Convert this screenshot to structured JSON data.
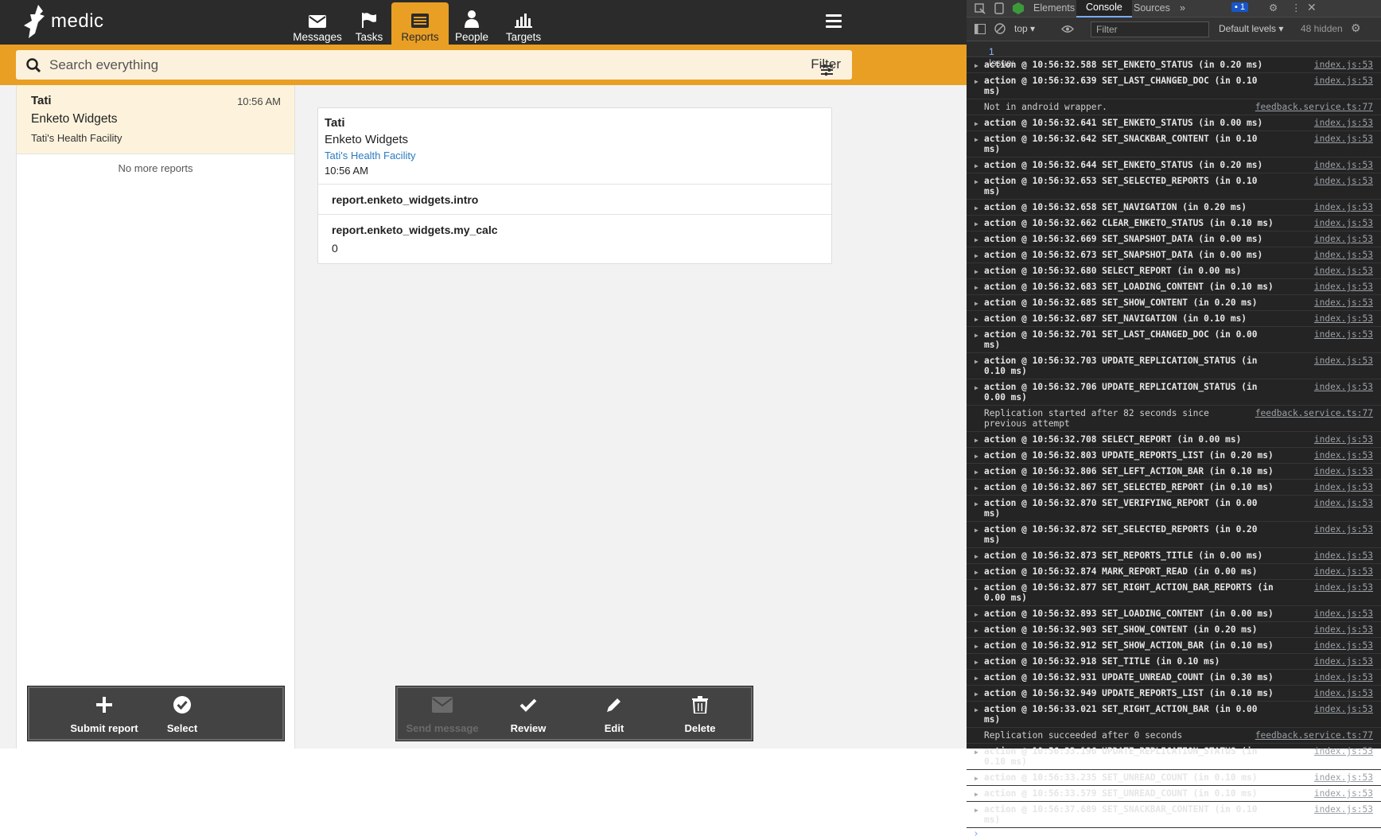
{
  "app": {
    "logo_text": "medic",
    "tabs": [
      {
        "label": "Messages",
        "icon": "envelope-icon",
        "active": false
      },
      {
        "label": "Tasks",
        "icon": "flag-icon",
        "active": false
      },
      {
        "label": "Reports",
        "icon": "list-icon",
        "active": true
      },
      {
        "label": "People",
        "icon": "person-icon",
        "active": false
      },
      {
        "label": "Targets",
        "icon": "bar-chart-icon",
        "active": false
      }
    ],
    "accent_color": "#e99f24",
    "search": {
      "placeholder": "Search everything",
      "value": ""
    },
    "filter_label": "Filter"
  },
  "report_list": {
    "items": [
      {
        "name": "Tati",
        "time": "10:56 AM",
        "form": "Enketo Widgets",
        "place": "Tati's Health Facility",
        "selected": true
      }
    ],
    "footer": "No more reports"
  },
  "report_detail": {
    "name": "Tati",
    "form": "Enketo Widgets",
    "place": "Tati's Health Facility",
    "time": "10:56 AM",
    "fields": [
      {
        "label": "report.enketo_widgets.intro",
        "value": ""
      },
      {
        "label": "report.enketo_widgets.my_calc",
        "value": "0"
      }
    ]
  },
  "left_actions": [
    {
      "label": "Submit report",
      "icon": "plus-icon",
      "enabled": true
    },
    {
      "label": "Select",
      "icon": "check-circle-icon",
      "enabled": true
    }
  ],
  "right_actions": [
    {
      "label": "Send message",
      "icon": "envelope-icon",
      "enabled": false
    },
    {
      "label": "Review",
      "icon": "check-icon",
      "enabled": true
    },
    {
      "label": "Edit",
      "icon": "pencil-icon",
      "enabled": true
    },
    {
      "label": "Delete",
      "icon": "trash-icon",
      "enabled": true
    }
  ],
  "devtools": {
    "tabs": [
      "Elements",
      "Console",
      "Sources"
    ],
    "active_tab": "Console",
    "issue_badge": "1",
    "context": "top",
    "filter_placeholder": "Filter",
    "levels": "Default levels",
    "hidden": "48 hidden",
    "issues_bar": "1 Issue:",
    "issues_count": "1",
    "logs": [
      {
        "msg": "action @ 10:56:32.588 SET_ENKETO_STATUS (in 0.20 ms)",
        "src": "index.js:53",
        "expandable": true
      },
      {
        "msg": "action @ 10:56:32.639 SET_LAST_CHANGED_DOC (in 0.10 ms)",
        "src": "index.js:53",
        "expandable": true
      },
      {
        "msg": "Not in android wrapper.",
        "src": "feedback.service.ts:77",
        "expandable": false
      },
      {
        "msg": "action @ 10:56:32.641 SET_ENKETO_STATUS (in 0.00 ms)",
        "src": "index.js:53",
        "expandable": true
      },
      {
        "msg": "action @ 10:56:32.642 SET_SNACKBAR_CONTENT (in 0.10 ms)",
        "src": "index.js:53",
        "expandable": true
      },
      {
        "msg": "action @ 10:56:32.644 SET_ENKETO_STATUS (in 0.20 ms)",
        "src": "index.js:53",
        "expandable": true
      },
      {
        "msg": "action @ 10:56:32.653 SET_SELECTED_REPORTS (in 0.10 ms)",
        "src": "index.js:53",
        "expandable": true
      },
      {
        "msg": "action @ 10:56:32.658 SET_NAVIGATION (in 0.20 ms)",
        "src": "index.js:53",
        "expandable": true
      },
      {
        "msg": "action @ 10:56:32.662 CLEAR_ENKETO_STATUS (in 0.10 ms)",
        "src": "index.js:53",
        "expandable": true
      },
      {
        "msg": "action @ 10:56:32.669 SET_SNAPSHOT_DATA (in 0.00 ms)",
        "src": "index.js:53",
        "expandable": true
      },
      {
        "msg": "action @ 10:56:32.673 SET_SNAPSHOT_DATA (in 0.00 ms)",
        "src": "index.js:53",
        "expandable": true
      },
      {
        "msg": "action @ 10:56:32.680 SELECT_REPORT (in 0.00 ms)",
        "src": "index.js:53",
        "expandable": true
      },
      {
        "msg": "action @ 10:56:32.683 SET_LOADING_CONTENT (in 0.10 ms)",
        "src": "index.js:53",
        "expandable": true
      },
      {
        "msg": "action @ 10:56:32.685 SET_SHOW_CONTENT (in 0.20 ms)",
        "src": "index.js:53",
        "expandable": true
      },
      {
        "msg": "action @ 10:56:32.687 SET_NAVIGATION (in 0.10 ms)",
        "src": "index.js:53",
        "expandable": true
      },
      {
        "msg": "action @ 10:56:32.701 SET_LAST_CHANGED_DOC (in 0.00 ms)",
        "src": "index.js:53",
        "expandable": true
      },
      {
        "msg": "action @ 10:56:32.703 UPDATE_REPLICATION_STATUS (in 0.10 ms)",
        "src": "index.js:53",
        "expandable": true
      },
      {
        "msg": "action @ 10:56:32.706 UPDATE_REPLICATION_STATUS (in 0.00 ms)",
        "src": "index.js:53",
        "expandable": true
      },
      {
        "msg": "Replication started after 82 seconds since previous attempt",
        "src": "feedback.service.ts:77",
        "expandable": false
      },
      {
        "msg": "action @ 10:56:32.708 SELECT_REPORT (in 0.00 ms)",
        "src": "index.js:53",
        "expandable": true
      },
      {
        "msg": "action @ 10:56:32.803 UPDATE_REPORTS_LIST (in 0.20 ms)",
        "src": "index.js:53",
        "expandable": true
      },
      {
        "msg": "action @ 10:56:32.806 SET_LEFT_ACTION_BAR (in 0.10 ms)",
        "src": "index.js:53",
        "expandable": true
      },
      {
        "msg": "action @ 10:56:32.867 SET_SELECTED_REPORT (in 0.10 ms)",
        "src": "index.js:53",
        "expandable": true
      },
      {
        "msg": "action @ 10:56:32.870 SET_VERIFYING_REPORT (in 0.00 ms)",
        "src": "index.js:53",
        "expandable": true
      },
      {
        "msg": "action @ 10:56:32.872 SET_SELECTED_REPORTS (in 0.20 ms)",
        "src": "index.js:53",
        "expandable": true
      },
      {
        "msg": "action @ 10:56:32.873 SET_REPORTS_TITLE (in 0.00 ms)",
        "src": "index.js:53",
        "expandable": true
      },
      {
        "msg": "action @ 10:56:32.874 MARK_REPORT_READ (in 0.00 ms)",
        "src": "index.js:53",
        "expandable": true
      },
      {
        "msg": "action @ 10:56:32.877 SET_RIGHT_ACTION_BAR_REPORTS (in 0.00 ms)",
        "src": "index.js:53",
        "expandable": true
      },
      {
        "msg": "action @ 10:56:32.893 SET_LOADING_CONTENT (in 0.00 ms)",
        "src": "index.js:53",
        "expandable": true
      },
      {
        "msg": "action @ 10:56:32.903 SET_SHOW_CONTENT (in 0.20 ms)",
        "src": "index.js:53",
        "expandable": true
      },
      {
        "msg": "action @ 10:56:32.912 SET_SHOW_ACTION_BAR (in 0.10 ms)",
        "src": "index.js:53",
        "expandable": true
      },
      {
        "msg": "action @ 10:56:32.918 SET_TITLE (in 0.10 ms)",
        "src": "index.js:53",
        "expandable": true
      },
      {
        "msg": "action @ 10:56:32.931 UPDATE_UNREAD_COUNT (in 0.30 ms)",
        "src": "index.js:53",
        "expandable": true
      },
      {
        "msg": "action @ 10:56:32.949 UPDATE_REPORTS_LIST (in 0.10 ms)",
        "src": "index.js:53",
        "expandable": true
      },
      {
        "msg": "action @ 10:56:33.021 SET_RIGHT_ACTION_BAR (in 0.00 ms)",
        "src": "index.js:53",
        "expandable": true
      },
      {
        "msg": "Replication succeeded after 0 seconds",
        "src": "feedback.service.ts:77",
        "expandable": false
      },
      {
        "msg": "action @ 10:56:33.196 UPDATE_REPLICATION_STATUS (in 0.10 ms)",
        "src": "index.js:53",
        "expandable": true
      },
      {
        "msg": "action @ 10:56:33.235 SET_UNREAD_COUNT (in 0.10 ms)",
        "src": "index.js:53",
        "expandable": true
      },
      {
        "msg": "action @ 10:56:33.579 SET_UNREAD_COUNT (in 0.10 ms)",
        "src": "index.js:53",
        "expandable": true
      },
      {
        "msg": "action @ 10:56:37.689 SET_SNACKBAR_CONTENT (in 0.10 ms)",
        "src": "index.js:53",
        "expandable": true
      }
    ],
    "prompt": "›"
  }
}
